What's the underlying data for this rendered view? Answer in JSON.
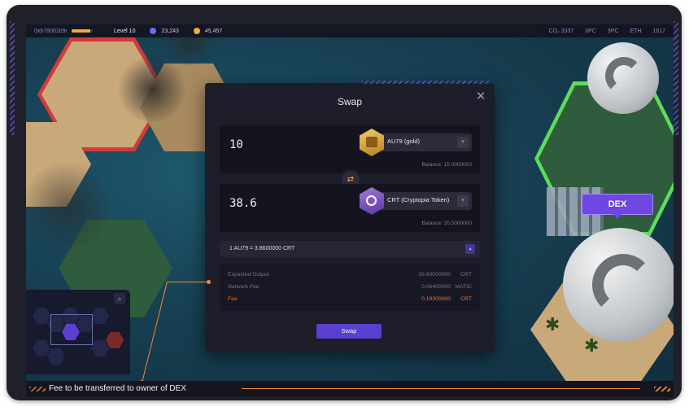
{
  "hud": {
    "address": "0xb78081b9e…",
    "level_label": "Level 10",
    "xp_progress": 0.9,
    "currency_1": "23,243",
    "currency_2": "45,457",
    "right_items": [
      "CO₂ 3337",
      "3PC",
      "3PC",
      "ETH",
      "1617"
    ]
  },
  "modal": {
    "title": "Swap",
    "from": {
      "amount": "10",
      "token_name": "AU79 (gold)",
      "balance": "Balance: 15.0000000"
    },
    "to": {
      "amount": "38.6",
      "token_name": "CRT (Cryptopia Token)",
      "balance": "Balance: 20.5000000"
    },
    "rate": "1 AU79 = 3.8600000 CRT",
    "details": [
      {
        "label": "Expected Output",
        "value": "38.60000000",
        "unit": "CRT"
      },
      {
        "label": "Network Fee",
        "value": "0.06400000",
        "unit": "MATIC"
      },
      {
        "label": "Fee",
        "value": "0.19300000",
        "unit": "CRT"
      }
    ],
    "swap_button": "Swap"
  },
  "dex_label": "DEX",
  "caption": "Fee to be transferred to owner of DEX",
  "colors": {
    "accent_purple": "#5a3fd1",
    "fee_orange": "#e8743a",
    "gold": "#f2a93b"
  },
  "icons": [
    "close-icon",
    "swap-arrows-icon",
    "gold-token-icon",
    "crt-token-icon",
    "chevron-down-icon",
    "chevron-up-icon",
    "search-icon"
  ]
}
